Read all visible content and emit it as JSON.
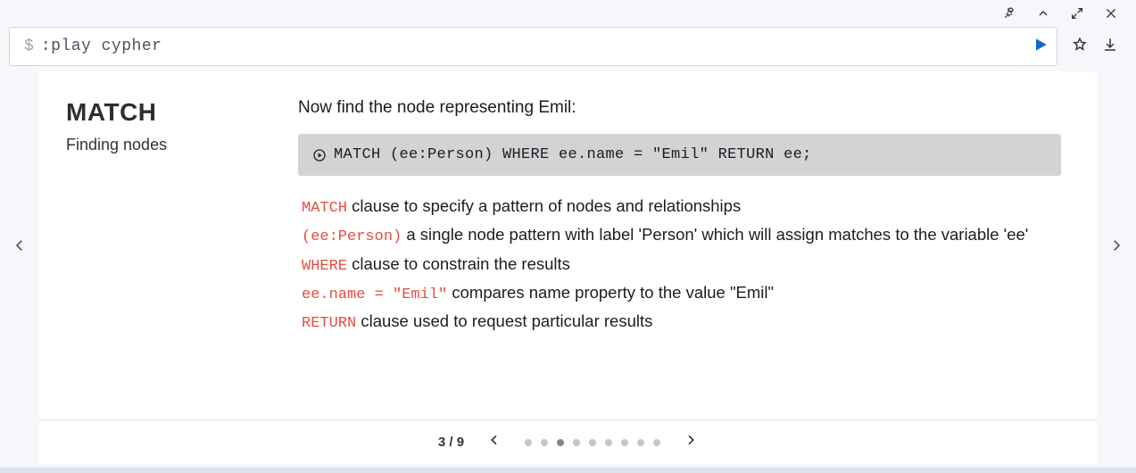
{
  "command": {
    "prompt": "$",
    "text": ":play cypher"
  },
  "sidebar": {
    "title": "MATCH",
    "subtitle": "Finding nodes"
  },
  "content": {
    "intro": "Now find the node representing Emil:",
    "code": "MATCH (ee:Person) WHERE ee.name = \"Emil\" RETURN ee;",
    "bullets": [
      {
        "kw": "MATCH",
        "text": " clause to specify a pattern of nodes and relationships"
      },
      {
        "kw": "(ee:Person)",
        "text": " a single node pattern with label 'Person' which will assign matches to the variable 'ee'"
      },
      {
        "kw": "WHERE",
        "text": " clause to constrain the results"
      },
      {
        "kw": "ee.name = \"Emil\"",
        "text": " compares name property to the value \"Emil\""
      },
      {
        "kw": "RETURN",
        "text": " clause used to request particular results"
      }
    ]
  },
  "pager": {
    "current": 3,
    "total": 9,
    "label": "3 / 9"
  }
}
